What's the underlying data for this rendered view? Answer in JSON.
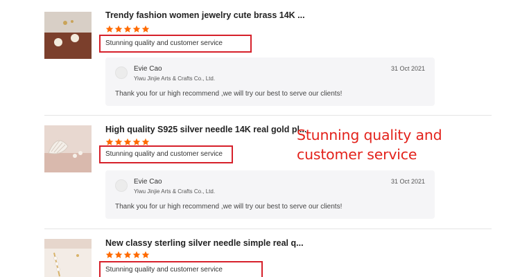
{
  "colors": {
    "star": "#ff6a00",
    "highlight_box": "#d6202a",
    "overlay_text": "#e3221b",
    "reply_bg": "#f5f5f7"
  },
  "overlay": {
    "text": "Stunning quality and customer service"
  },
  "reviews": [
    {
      "product_title": "Trendy fashion women jewelry cute brass 14K ...",
      "rating": 5,
      "comment": "Stunning quality and customer service",
      "thumbnail_icon": "pearl-earrings-photo",
      "reply": {
        "seller_name": "Evie Cao",
        "seller_company": "Yiwu Jinjie Arts & Crafts Co., Ltd.",
        "date": "31 Oct 2021",
        "text": "Thank you for ur high recommend ,we will try our best to serve our clients!"
      }
    },
    {
      "product_title": "High quality S925 silver needle 14K real gold pl...",
      "rating": 5,
      "comment": "Stunning quality and customer service",
      "thumbnail_icon": "shell-earrings-photo",
      "reply": {
        "seller_name": "Evie Cao",
        "seller_company": "Yiwu Jinjie Arts & Crafts Co., Ltd.",
        "date": "31 Oct 2021",
        "text": "Thank you for ur high recommend ,we will try our best to serve our clients!"
      }
    },
    {
      "product_title": "New classy sterling silver needle simple real q...",
      "rating": 5,
      "comment": "Stunning quality and customer service",
      "thumbnail_icon": "pearl-bar-earrings-photo"
    }
  ]
}
